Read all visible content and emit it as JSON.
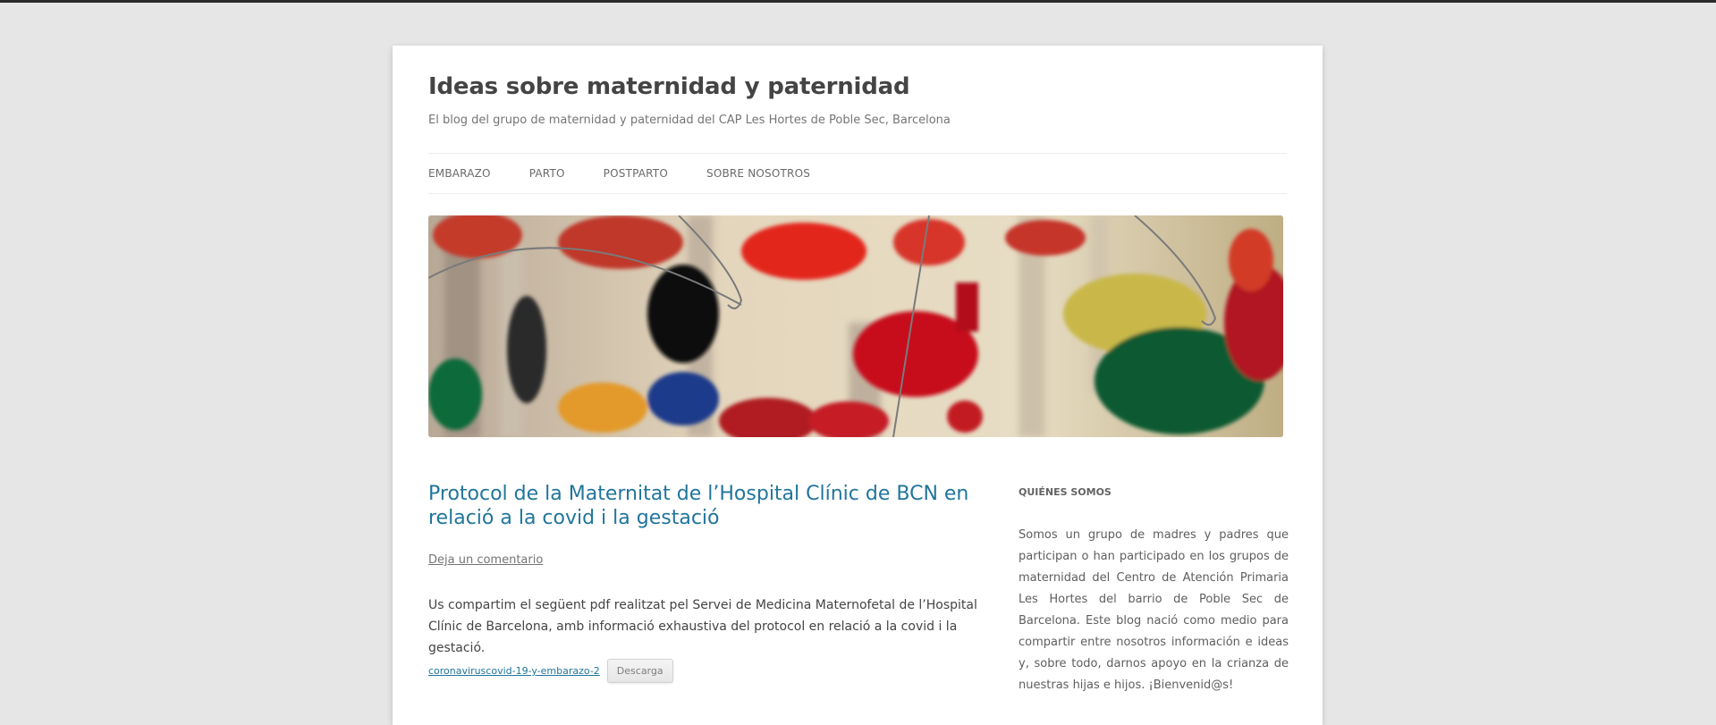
{
  "site": {
    "title": "Ideas sobre maternidad y paternidad",
    "description": "El blog del grupo de maternidad y paternidad del CAP Les Hortes de Poble Sec, Barcelona"
  },
  "nav": {
    "items": [
      {
        "label": "EMBARAZO"
      },
      {
        "label": "PARTO"
      },
      {
        "label": "POSTPARTO"
      },
      {
        "label": "SOBRE NOSOTROS"
      }
    ]
  },
  "post": {
    "title": "Protocol de la Maternitat de l’Hospital Clínic de BCN en rela­ció a la covid i la gestació",
    "comment_link": "Deja un comentario",
    "content": "Us compartim el següent pdf realitzat pel Servei de Medicina Maternofetal de l’Hospital Clínic de Barcelona, amb informació exhaustiva del protocol en relació a la covid i la gestació.",
    "file_link": "coronaviruscovid-19-y-embarazo-2",
    "download_label": "Descarga"
  },
  "sidebar": {
    "widget_title": "QUIÉNES SOMOS",
    "widget_text": "Somos un grupo de madres y padres que participan o han participado en los grupos de maternidad del Centro de Atención Primaria Les Hortes del barrio de Poble Sec de Barcelona. Este blog nació como medio para compartir entre nosotros información e ideas y, sobre todo, darnos apoyo en la crianza de nuestras hijas e hijos. ¡Bienvenid@s!"
  },
  "colors": {
    "background": "#e6e6e6",
    "link": "#21759b",
    "text": "#444444"
  }
}
